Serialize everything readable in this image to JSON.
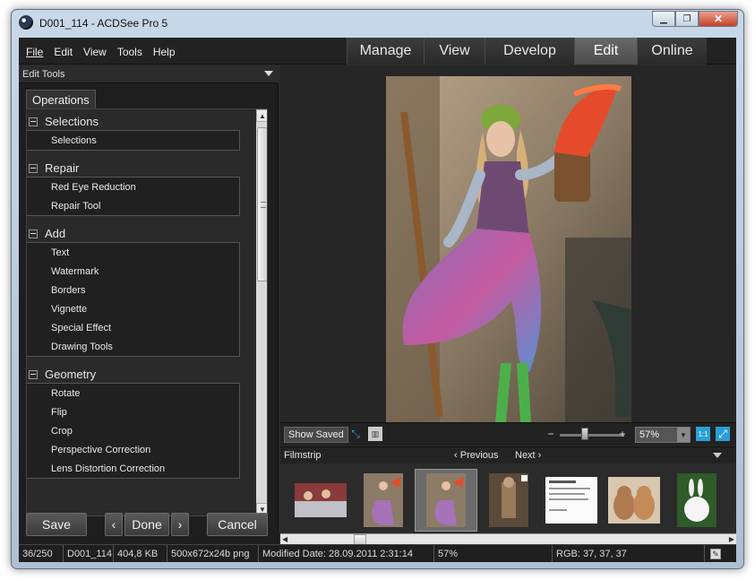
{
  "window": {
    "title": "D001_114 - ACDSee Pro 5",
    "minimize_glyph": "▁",
    "maximize_glyph": "❐",
    "close_glyph": "✕"
  },
  "menu": [
    "File",
    "Edit",
    "View",
    "Tools",
    "Help"
  ],
  "modes": [
    {
      "label": "Manage",
      "active": false
    },
    {
      "label": "View",
      "active": false
    },
    {
      "label": "Develop",
      "active": false
    },
    {
      "label": "Edit",
      "active": true
    },
    {
      "label": "Online",
      "active": false
    }
  ],
  "panel": {
    "header": "Edit Tools",
    "tab": "Operations",
    "groups": [
      {
        "title": "Selections",
        "items": [
          "Selections"
        ]
      },
      {
        "title": "Repair",
        "items": [
          "Red Eye Reduction",
          "Repair Tool"
        ]
      },
      {
        "title": "Add",
        "items": [
          "Text",
          "Watermark",
          "Borders",
          "Vignette",
          "Special Effect",
          "Drawing Tools"
        ]
      },
      {
        "title": "Geometry",
        "items": [
          "Rotate",
          "Flip",
          "Crop",
          "Perspective Correction",
          "Lens Distortion Correction"
        ]
      }
    ],
    "buttons": {
      "save": "Save",
      "prev": "‹",
      "done": "Done",
      "next": "›",
      "cancel": "Cancel"
    }
  },
  "viewer_toolbar": {
    "show_saved": "Show Saved",
    "zoom_minus": "−",
    "zoom_plus": "+",
    "zoom_value": "57%",
    "dropdown_glyph": "▼",
    "one_to_one": "1:1",
    "zoom_level_fraction": 0.33
  },
  "filmstrip": {
    "label": "Filmstrip",
    "previous": "Previous",
    "next": "Next",
    "selected_index": 2
  },
  "status": {
    "position": "36/250",
    "name": "D001_114",
    "size": "404,8 KB",
    "dimensions": "500x672x24b png",
    "modified": "Modified Date: 28.09.2011 2:31:14",
    "zoom": "57%",
    "rgb": "RGB: 37, 37, 37"
  },
  "colors": {
    "accent_blue": "#2a9fd8",
    "active_tab": "#5a5a5a",
    "panel_bg": "#1e1e1e"
  }
}
